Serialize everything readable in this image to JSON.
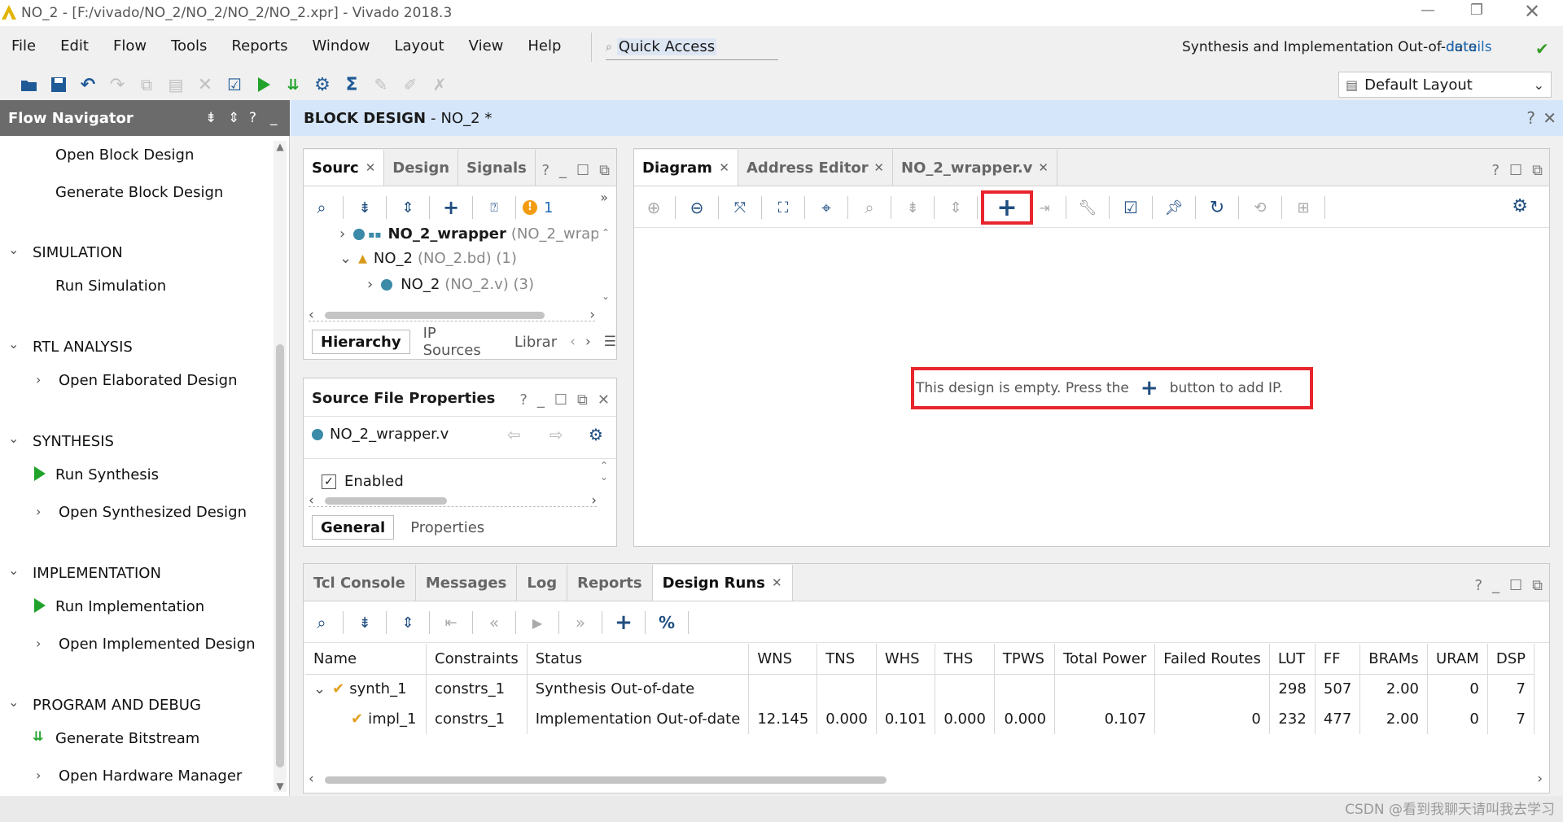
{
  "window": {
    "title": "NO_2 - [F:/vivado/NO_2/NO_2/NO_2/NO_2.xpr] - Vivado 2018.3"
  },
  "menu": [
    "File",
    "Edit",
    "Flow",
    "Tools",
    "Reports",
    "Window",
    "Layout",
    "View",
    "Help"
  ],
  "quick_access": "Quick Access",
  "status": {
    "text": "Synthesis and Implementation Out-of-date",
    "link": "details"
  },
  "layout_select": "Default Layout",
  "flow_nav": {
    "title": "Flow Navigator",
    "items": {
      "open_block": "Open Block Design",
      "gen_block": "Generate Block Design",
      "sim_head": "SIMULATION",
      "run_sim": "Run Simulation",
      "rtl_head": "RTL ANALYSIS",
      "open_elab": "Open Elaborated Design",
      "syn_head": "SYNTHESIS",
      "run_syn": "Run Synthesis",
      "open_syn": "Open Synthesized Design",
      "impl_head": "IMPLEMENTATION",
      "run_impl": "Run Implementation",
      "open_impl": "Open Implemented Design",
      "pd_head": "PROGRAM AND DEBUG",
      "gen_bit": "Generate Bitstream",
      "open_hw": "Open Hardware Manager"
    }
  },
  "block_design": {
    "label": "BLOCK DESIGN",
    "name": "NO_2 *"
  },
  "sources": {
    "tabs": [
      "Sourc",
      "Design",
      "Signals"
    ],
    "warning_count": "1",
    "tree": [
      {
        "name": "NO_2_wrapper",
        "detail": "(NO_2_wrapp"
      },
      {
        "name": "NO_2",
        "detail": "(NO_2.bd) (1)"
      },
      {
        "name": "NO_2",
        "detail": "(NO_2.v) (3)"
      }
    ],
    "subtabs": [
      "Hierarchy",
      "IP Sources",
      "Librar"
    ]
  },
  "props": {
    "title": "Source File Properties",
    "file": "NO_2_wrapper.v",
    "enabled": "Enabled",
    "subtabs": [
      "General",
      "Properties"
    ]
  },
  "diagram": {
    "tabs": [
      "Diagram",
      "Address Editor",
      "NO_2_wrapper.v"
    ],
    "msg_before": "This design is empty. Press the",
    "msg_after": "button to add IP.",
    "accent": "#e8252d"
  },
  "bottom": {
    "tabs": [
      "Tcl Console",
      "Messages",
      "Log",
      "Reports",
      "Design Runs"
    ],
    "columns": [
      "Name",
      "Constraints",
      "Status",
      "WNS",
      "TNS",
      "WHS",
      "THS",
      "TPWS",
      "Total Power",
      "Failed Routes",
      "LUT",
      "FF",
      "BRAMs",
      "URAM",
      "DSP"
    ],
    "rows": [
      [
        "synth_1",
        "constrs_1",
        "Synthesis Out-of-date",
        "",
        "",
        "",
        "",
        "",
        "",
        "",
        "298",
        "507",
        "2.00",
        "0",
        "7"
      ],
      [
        "impl_1",
        "constrs_1",
        "Implementation Out-of-date",
        "12.145",
        "0.000",
        "0.101",
        "0.000",
        "0.000",
        "0.107",
        "0",
        "232",
        "477",
        "2.00",
        "0",
        "7"
      ]
    ]
  },
  "watermark": "CSDN @看到我聊天请叫我去学习"
}
